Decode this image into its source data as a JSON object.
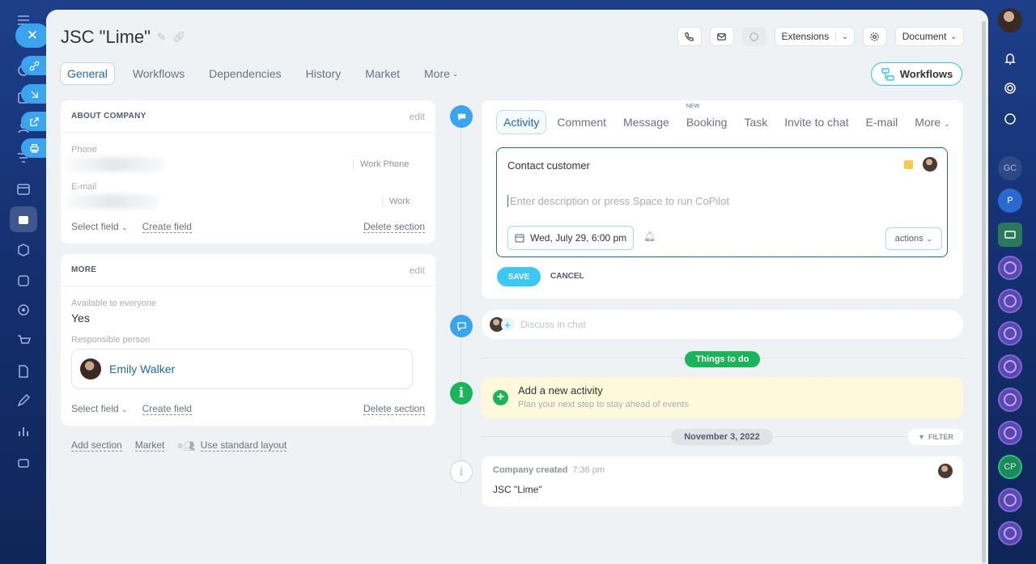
{
  "header": {
    "title": "JSC \"Lime\"",
    "extensions_label": "Extensions",
    "document_label": "Document"
  },
  "tabs": [
    "General",
    "Workflows",
    "Dependencies",
    "History",
    "Market",
    "More"
  ],
  "workflows_button": "Workflows",
  "about_company": {
    "heading": "ABOUT COMPANY",
    "edit": "edit",
    "phone_label": "Phone",
    "phone_type": "Work Phone",
    "email_label": "E-mail",
    "email_type": "Work",
    "select_field": "Select field",
    "create_field": "Create field",
    "delete_section": "Delete section"
  },
  "more_section": {
    "heading": "MORE",
    "edit": "edit",
    "available_label": "Available to everyone",
    "available_value": "Yes",
    "responsible_label": "Responsible person",
    "responsible_name": "Emily Walker",
    "select_field": "Select field",
    "create_field": "Create field",
    "delete_section": "Delete section"
  },
  "bottom_links": {
    "add_section": "Add section",
    "market": "Market",
    "standard_layout": "Use standard layout"
  },
  "activity_tabs": [
    {
      "label": "Activity",
      "badge": ""
    },
    {
      "label": "Comment",
      "badge": ""
    },
    {
      "label": "Message",
      "badge": ""
    },
    {
      "label": "Booking",
      "badge": "NEW"
    },
    {
      "label": "Task",
      "badge": ""
    },
    {
      "label": "Invite to chat",
      "badge": ""
    },
    {
      "label": "E-mail",
      "badge": ""
    },
    {
      "label": "More",
      "badge": ""
    }
  ],
  "editor": {
    "title": "Contact customer",
    "placeholder": "Enter description or press Space to run CoPilot",
    "date": "Wed, July 29, 6:00 pm",
    "actions": "actions"
  },
  "save_label": "SAVE",
  "cancel_label": "CANCEL",
  "chat_placeholder": "Discuss in chat",
  "things_to_do": "Things to do",
  "todo": {
    "title": "Add a new activity",
    "subtitle": "Plan your next step to stay ahead of events"
  },
  "date_pill": "November 3, 2022",
  "filter_label": "FILTER",
  "history": {
    "event": "Company created",
    "time": "7:36 pm",
    "company": "JSC \"Lime\""
  },
  "right_rail": {
    "gc": "GC",
    "p": "P",
    "cp": "CP"
  },
  "colors": {
    "accent": "#2fc6f6",
    "link": "#2067b0",
    "green": "#1bb559",
    "todo_bg": "#fff9dc"
  }
}
